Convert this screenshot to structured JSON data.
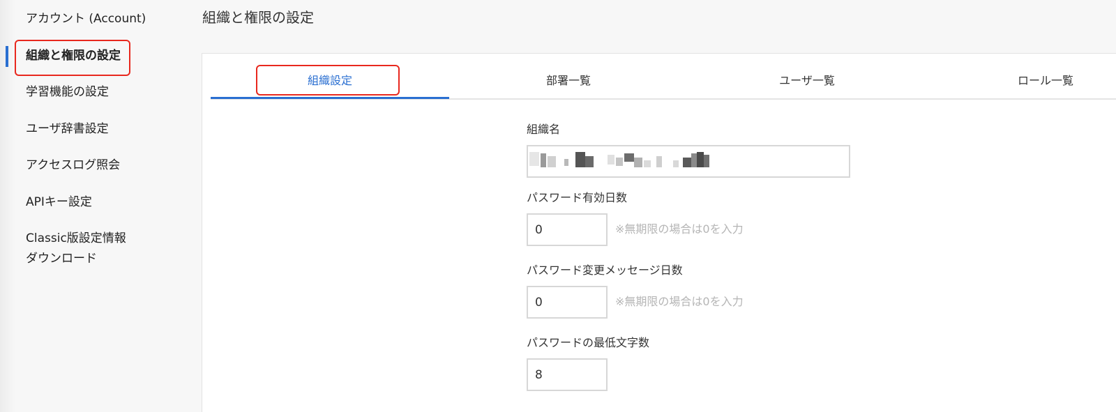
{
  "sidebar": {
    "items": [
      {
        "label": "アカウント (Account)"
      },
      {
        "label": "組織と権限の設定"
      },
      {
        "label": "学習機能の設定"
      },
      {
        "label": "ユーザ辞書設定"
      },
      {
        "label": "アクセスログ照会"
      },
      {
        "label": "APIキー設定"
      },
      {
        "label": "Classic版設定情報",
        "label_line2": "ダウンロード"
      }
    ],
    "active_index": 1
  },
  "page": {
    "title": "組織と権限の設定"
  },
  "tabs": [
    {
      "label": "組織設定",
      "active": true
    },
    {
      "label": "部署一覧",
      "active": false
    },
    {
      "label": "ユーザ一覧",
      "active": false
    },
    {
      "label": "ロール一覧",
      "active": false
    }
  ],
  "form": {
    "org_name": {
      "label": "組織名",
      "value": "",
      "note": "value pixelated"
    },
    "password_valid_days": {
      "label": "パスワード有効日数",
      "value": "0",
      "hint": "※無期限の場合は0を入力"
    },
    "password_change_msg_days": {
      "label": "パスワード変更メッセージ日数",
      "value": "0",
      "hint": "※無期限の場合は0を入力"
    },
    "password_min_length": {
      "label": "パスワードの最低文字数",
      "value": "8"
    }
  },
  "colors": {
    "accent": "#2a6fd1",
    "annotation": "#e8281e",
    "hint": "#b5b5b5"
  }
}
